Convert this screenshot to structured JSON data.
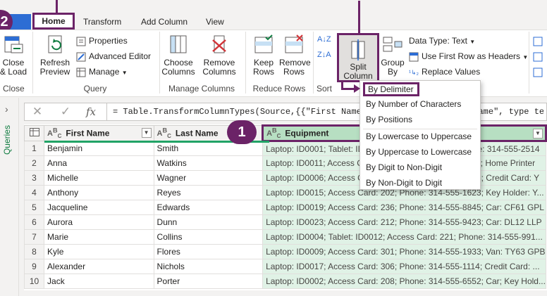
{
  "tabs": [
    "Home",
    "Transform",
    "Add Column",
    "View"
  ],
  "ribbon": {
    "close_load": "Close & Load",
    "close_group": "Close",
    "refresh_preview": "Refresh Preview",
    "properties": "Properties",
    "advanced_editor": "Advanced Editor",
    "manage": "Manage",
    "query_group": "Query",
    "choose_columns": "Choose Columns",
    "remove_columns": "Remove Columns",
    "manage_columns_group": "Manage Columns",
    "keep_rows": "Keep Rows",
    "remove_rows": "Remove Rows",
    "reduce_rows_group": "Reduce Rows",
    "sort_group": "Sort",
    "split_column": "Split Column",
    "group_by": "Group By",
    "data_type": "Data Type: Text",
    "use_first_row": "Use First Row as Headers",
    "replace_values": "Replace Values"
  },
  "split_menu": {
    "items": [
      "By Delimiter",
      "By Number of Characters",
      "By Positions",
      "By Lowercase to Uppercase",
      "By Uppercase to Lowercase",
      "By Digit to Non-Digit",
      "By Non-Digit to Digit"
    ]
  },
  "left_pane": {
    "label": "Queries"
  },
  "formula": {
    "text": "= Table.TransformColumnTypes(Source,{{\"First Name\", type text}, {\"Last Name\", type text}, {\"Eq"
  },
  "callouts": {
    "one": "1",
    "two": "2"
  },
  "table": {
    "headers": [
      "First Name",
      "Last Name",
      "Equipment"
    ],
    "rows": [
      {
        "n": "1",
        "first": "Benjamin",
        "last": "Smith",
        "equip": "Laptop: ID0001; Tablet: ID0001; Access Card: 211; Phone: 314-555-2514"
      },
      {
        "n": "2",
        "first": "Anna",
        "last": "Watkins",
        "equip": "Laptop: ID0011; Access Card: 228; Phone: 314-555-8823; Home Printer"
      },
      {
        "n": "3",
        "first": "Michelle",
        "last": "Wagner",
        "equip": "Laptop: ID0006; Access Card: 217; Phone: 314-555-1208; Credit Card: Y"
      },
      {
        "n": "4",
        "first": "Anthony",
        "last": "Reyes",
        "equip": "Laptop: ID0015; Access Card: 202; Phone: 314-555-1623; Key Holder: Y..."
      },
      {
        "n": "5",
        "first": "Jacqueline",
        "last": "Edwards",
        "equip": "Laptop: ID0019; Access Card: 236; Phone: 314-555-8845; Car: CF61 GPL"
      },
      {
        "n": "6",
        "first": "Aurora",
        "last": "Dunn",
        "equip": "Laptop: ID0023; Access Card: 212; Phone: 314-555-9423; Car: DL12 LLP"
      },
      {
        "n": "7",
        "first": "Marie",
        "last": "Collins",
        "equip": "Laptop: ID0004; Tablet: ID0012; Access Card: 221; Phone: 314-555-991..."
      },
      {
        "n": "8",
        "first": "Kyle",
        "last": "Flores",
        "equip": "Laptop: ID0009; Access Card: 301; Phone: 314-555-1933; Van: TY63 GPB"
      },
      {
        "n": "9",
        "first": "Alexander",
        "last": "Nichols",
        "equip": "Laptop: ID0017; Access Card: 306; Phone: 314-555-1114; Credit Card: ..."
      },
      {
        "n": "10",
        "first": "Jack",
        "last": "Porter",
        "equip": "Laptop: ID0002; Access Card: 208; Phone: 314-555-6552; Car; Key Hold..."
      }
    ]
  }
}
